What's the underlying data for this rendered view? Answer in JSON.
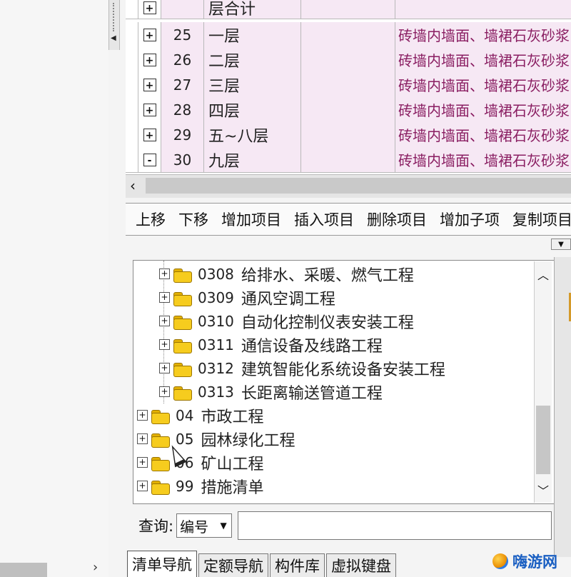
{
  "grid": {
    "header_row": {
      "toggle": "+",
      "name": "层合计"
    },
    "rows": [
      {
        "toggle": "+",
        "num": "25",
        "name": "一层",
        "desc": "砖墙内墙面、墙裙石灰砂浆"
      },
      {
        "toggle": "+",
        "num": "26",
        "name": "二层",
        "desc": "砖墙内墙面、墙裙石灰砂浆"
      },
      {
        "toggle": "+",
        "num": "27",
        "name": "三层",
        "desc": "砖墙内墙面、墙裙石灰砂浆"
      },
      {
        "toggle": "+",
        "num": "28",
        "name": "四层",
        "desc": "砖墙内墙面、墙裙石灰砂浆"
      },
      {
        "toggle": "+",
        "num": "29",
        "name": "五~八层",
        "desc": "砖墙内墙面、墙裙石灰砂浆"
      },
      {
        "toggle": "-",
        "num": "30",
        "name": "九层",
        "desc": "砖墙内墙面、墙裙石灰砂浆"
      }
    ]
  },
  "toolbar": {
    "move_up": "上移",
    "move_down": "下移",
    "add_item": "增加项目",
    "insert_item": "插入项目",
    "delete_item": "删除项目",
    "add_subitem": "增加子项",
    "copy_item": "复制项目"
  },
  "tree": {
    "items": [
      {
        "expander": "+",
        "code": "0308",
        "label": "给排水、采暖、燃气工程"
      },
      {
        "expander": "+",
        "code": "0309",
        "label": "通风空调工程"
      },
      {
        "expander": "+",
        "code": "0310",
        "label": "自动化控制仪表安装工程"
      },
      {
        "expander": "+",
        "code": "0311",
        "label": "通信设备及线路工程"
      },
      {
        "expander": "+",
        "code": "0312",
        "label": "建筑智能化系统设备安装工程"
      },
      {
        "expander": "+",
        "code": "0313",
        "label": "长距离输送管道工程"
      },
      {
        "expander": "+",
        "code": "04",
        "label": "市政工程"
      },
      {
        "expander": "+",
        "code": "05",
        "label": "园林绿化工程"
      },
      {
        "expander": "+",
        "code": "06",
        "label": "矿山工程"
      },
      {
        "expander": "+",
        "code": "99",
        "label": "措施清单"
      }
    ]
  },
  "query": {
    "label": "查询:",
    "select_value": "编号",
    "input_value": ""
  },
  "tabs": [
    "清单导航",
    "定额导航",
    "构件库",
    "虚拟键盘"
  ],
  "watermark": {
    "text": "嗨游网"
  },
  "colors": {
    "row_highlight": "#f6e8f4",
    "desc_text": "#8a1e62",
    "folder": "#f6cc1e"
  },
  "icons": {
    "folder": "folder-icon",
    "expander": "plus-box-icon",
    "dropdown": "chevron-down-icon"
  }
}
